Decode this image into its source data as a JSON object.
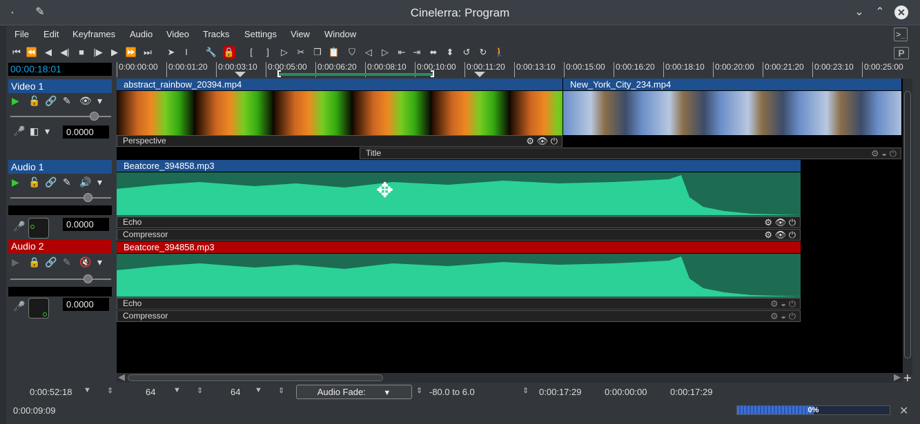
{
  "window": {
    "title": "Cinelerra: Program"
  },
  "menu": [
    "File",
    "Edit",
    "Keyframes",
    "Audio",
    "Video",
    "Tracks",
    "Settings",
    "View",
    "Window"
  ],
  "clock": "00:00:18:01",
  "ruler": {
    "ticks": [
      "0:00:00:00",
      "0:00:01:20",
      "0:00:03:10",
      "0:00:05:00",
      "0:00:06:20",
      "0:00:08:10",
      "0:00:10:00",
      "0:00:11:20",
      "0:00:13:10",
      "0:00:15:00",
      "0:00:16:20",
      "0:00:18:10",
      "0:00:20:00",
      "0:00:21:20",
      "0:00:23:10",
      "0:00:25:00"
    ]
  },
  "tracks": [
    {
      "name": "Video 1",
      "type": "video",
      "value": "0.0000",
      "color": "#1e4f8f"
    },
    {
      "name": "Audio 1",
      "type": "audio",
      "value": "0.0000",
      "color": "#1e4f8f"
    },
    {
      "name": "Audio 2",
      "type": "audio",
      "value": "0.0000",
      "color": "#b00000"
    }
  ],
  "edits": {
    "video1_a": "abstract_rainbow_20394.mp4",
    "video1_b": "New_York_City_234.mp4",
    "video1_fx": "Perspective",
    "video1_fx2": "Title",
    "audio1": "Beatcore_394858.mp3",
    "audio1_fx1": "Echo",
    "audio1_fx2": "Compressor",
    "audio2": "Beatcore_394858.mp3",
    "audio2_fx1": "Echo",
    "audio2_fx2": "Compressor"
  },
  "status": {
    "duration": "0:00:52:18",
    "a": "64",
    "b": "64",
    "fade": "Audio Fade:",
    "range": "-80.0 to 6.0",
    "sel_start": "0:00:17:29",
    "sel_len": "0:00:00:00",
    "sel_end": "0:00:17:29",
    "position": "0:00:09:09",
    "progress_label": "0%",
    "progress_fraction": 0.5
  },
  "icons": {
    "pin": "pin-icon",
    "terminal": "terminal-icon",
    "p": "P"
  }
}
